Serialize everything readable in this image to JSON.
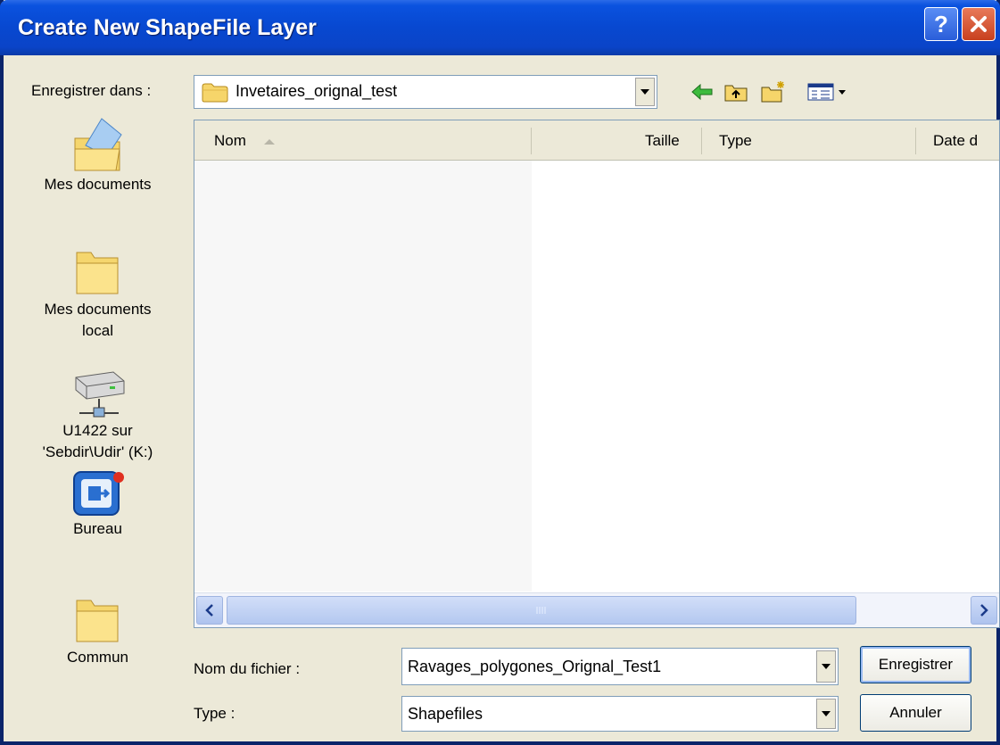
{
  "window": {
    "title": "Create New ShapeFile Layer"
  },
  "titlebar": {
    "help_icon": "?",
    "close_icon": "close-icon"
  },
  "save_in": {
    "label": "Enregistrer dans :",
    "value": "Invetaires_orignal_test"
  },
  "toolbar": {
    "icons": [
      "back-icon",
      "up-folder-icon",
      "new-folder-icon",
      "view-menu-icon"
    ]
  },
  "places": [
    {
      "label_line1": "Mes documents",
      "label_line2": "",
      "icon": "my-documents-icon"
    },
    {
      "label_line1": "Mes documents",
      "label_line2": "local",
      "icon": "folder-icon"
    },
    {
      "label_line1": "U1422 sur",
      "label_line2": "'Sebdir\\Udir' (K:)",
      "icon": "network-drive-icon"
    },
    {
      "label_line1": "Bureau",
      "label_line2": "",
      "icon": "desktop-icon"
    },
    {
      "label_line1": "Commun",
      "label_line2": "",
      "icon": "folder-icon"
    }
  ],
  "filelist": {
    "columns": [
      "Nom",
      "Taille",
      "Type",
      "Date d"
    ],
    "rows": []
  },
  "filename": {
    "label": "Nom du fichier :",
    "value": "Ravages_polygones_Orignal_Test1"
  },
  "filetype": {
    "label": "Type :",
    "value": "Shapefiles"
  },
  "buttons": {
    "save": "Enregistrer",
    "cancel": "Annuler"
  }
}
